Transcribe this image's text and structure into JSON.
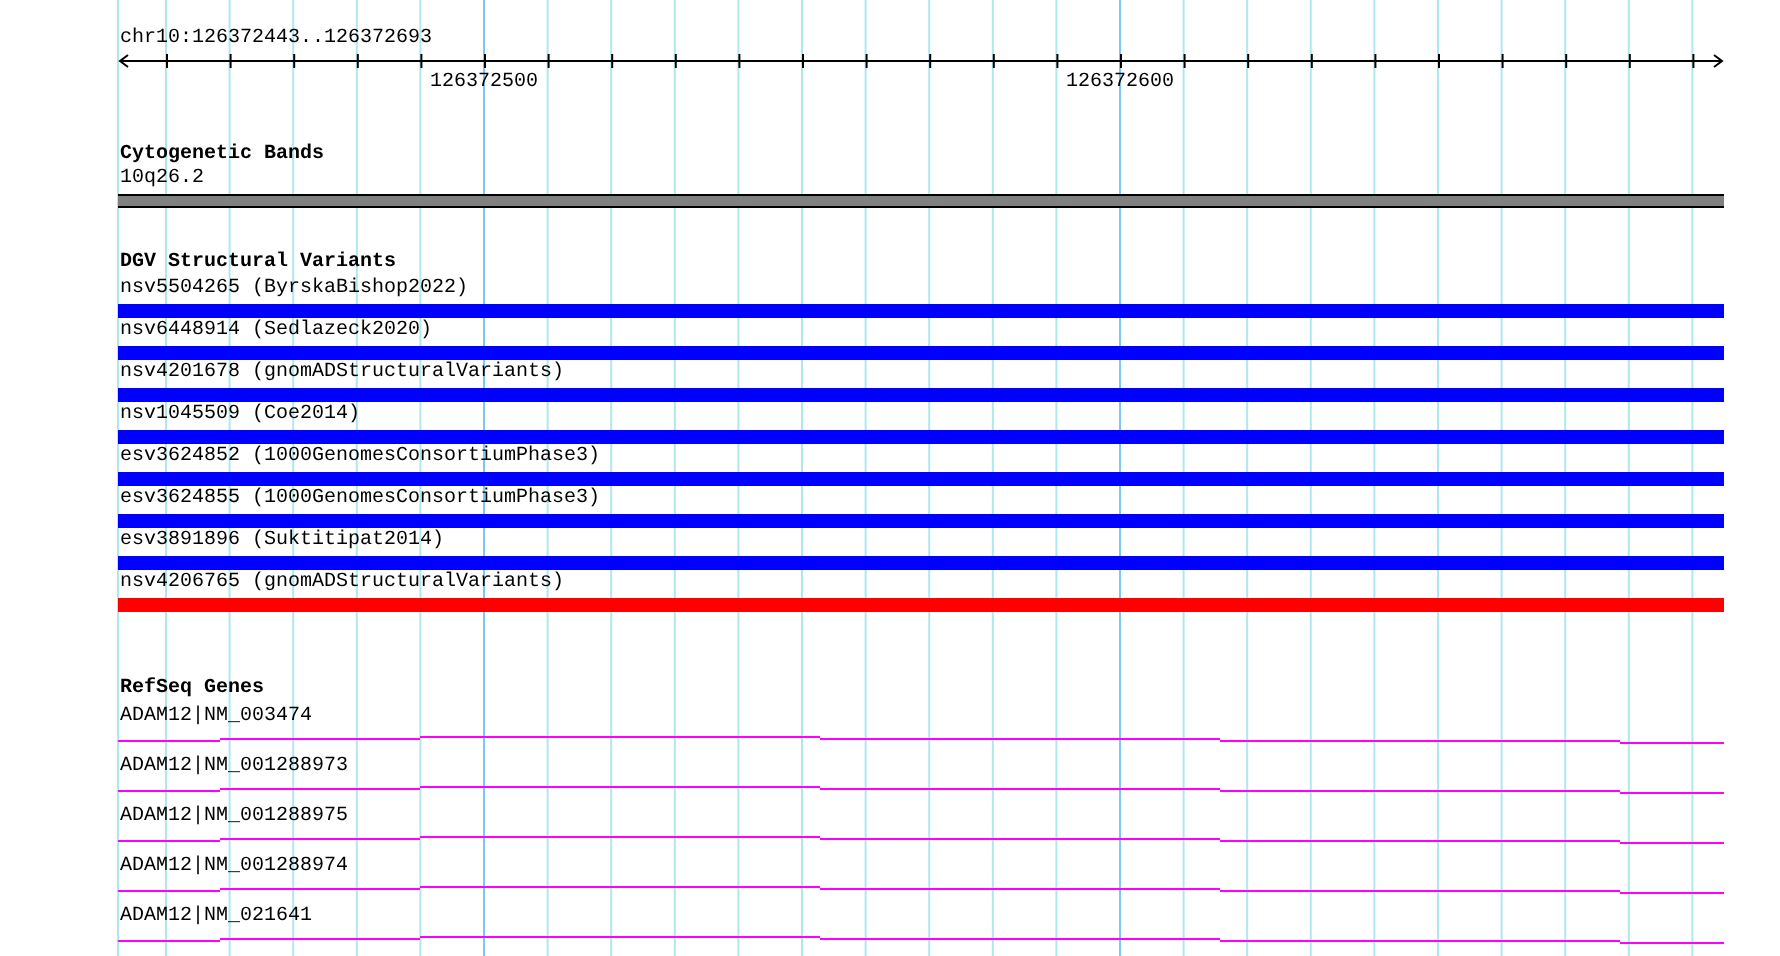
{
  "ruler": {
    "range": "chr10:126372443..126372693",
    "ticks": [
      "126372500",
      "126372600"
    ]
  },
  "tracks": [
    {
      "title": "Cytogenetic Bands",
      "kind": "band",
      "features": [
        {
          "label": "10q26.2",
          "color": "#808080"
        }
      ]
    },
    {
      "title": "DGV Structural Variants",
      "kind": "variant",
      "features": [
        {
          "label": "nsv5504265 (ByrskaBishop2022)",
          "color": "#0000ff"
        },
        {
          "label": "nsv6448914 (Sedlazeck2020)",
          "color": "#0000ff"
        },
        {
          "label": "nsv4201678 (gnomADStructuralVariants)",
          "color": "#0000ff"
        },
        {
          "label": "nsv1045509 (Coe2014)",
          "color": "#0000ff"
        },
        {
          "label": "esv3624852 (1000GenomesConsortiumPhase3)",
          "color": "#0000ff"
        },
        {
          "label": "esv3624855 (1000GenomesConsortiumPhase3)",
          "color": "#0000ff"
        },
        {
          "label": "esv3891896 (Suktitipat2014)",
          "color": "#0000ff"
        },
        {
          "label": "nsv4206765 (gnomADStructuralVariants)",
          "color": "#ff0000"
        }
      ]
    },
    {
      "title": "RefSeq Genes",
      "kind": "gene",
      "features": [
        {
          "label": "ADAM12|NM_003474"
        },
        {
          "label": "ADAM12|NM_001288973"
        },
        {
          "label": "ADAM12|NM_001288975"
        },
        {
          "label": "ADAM12|NM_001288974"
        },
        {
          "label": "ADAM12|NM_021641"
        }
      ]
    }
  ]
}
